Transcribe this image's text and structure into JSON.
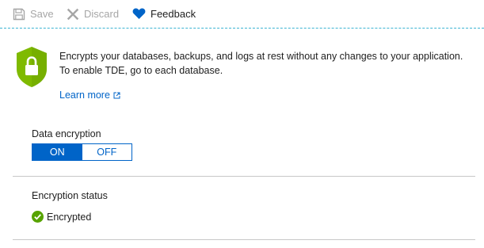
{
  "toolbar": {
    "save_label": "Save",
    "discard_label": "Discard",
    "feedback_label": "Feedback"
  },
  "info": {
    "description": "Encrypts your databases, backups, and logs at rest without any changes to your application. To enable TDE, go to each database.",
    "learn_more_label": "Learn more"
  },
  "data_encryption": {
    "label": "Data encryption",
    "options": [
      "ON",
      "OFF"
    ],
    "selected": "ON"
  },
  "encryption_status": {
    "label": "Encryption status",
    "value": "Encrypted"
  },
  "colors": {
    "accent": "#0064c8",
    "shield_green": "#7fba00",
    "success_green": "#57a300",
    "disabled_gray": "#a6a6a6"
  },
  "icons": {
    "save": "save-icon",
    "discard": "discard-icon",
    "feedback": "heart-icon",
    "shield": "shield-lock-icon",
    "external_link": "external-link-icon",
    "status": "check-circle-icon"
  }
}
